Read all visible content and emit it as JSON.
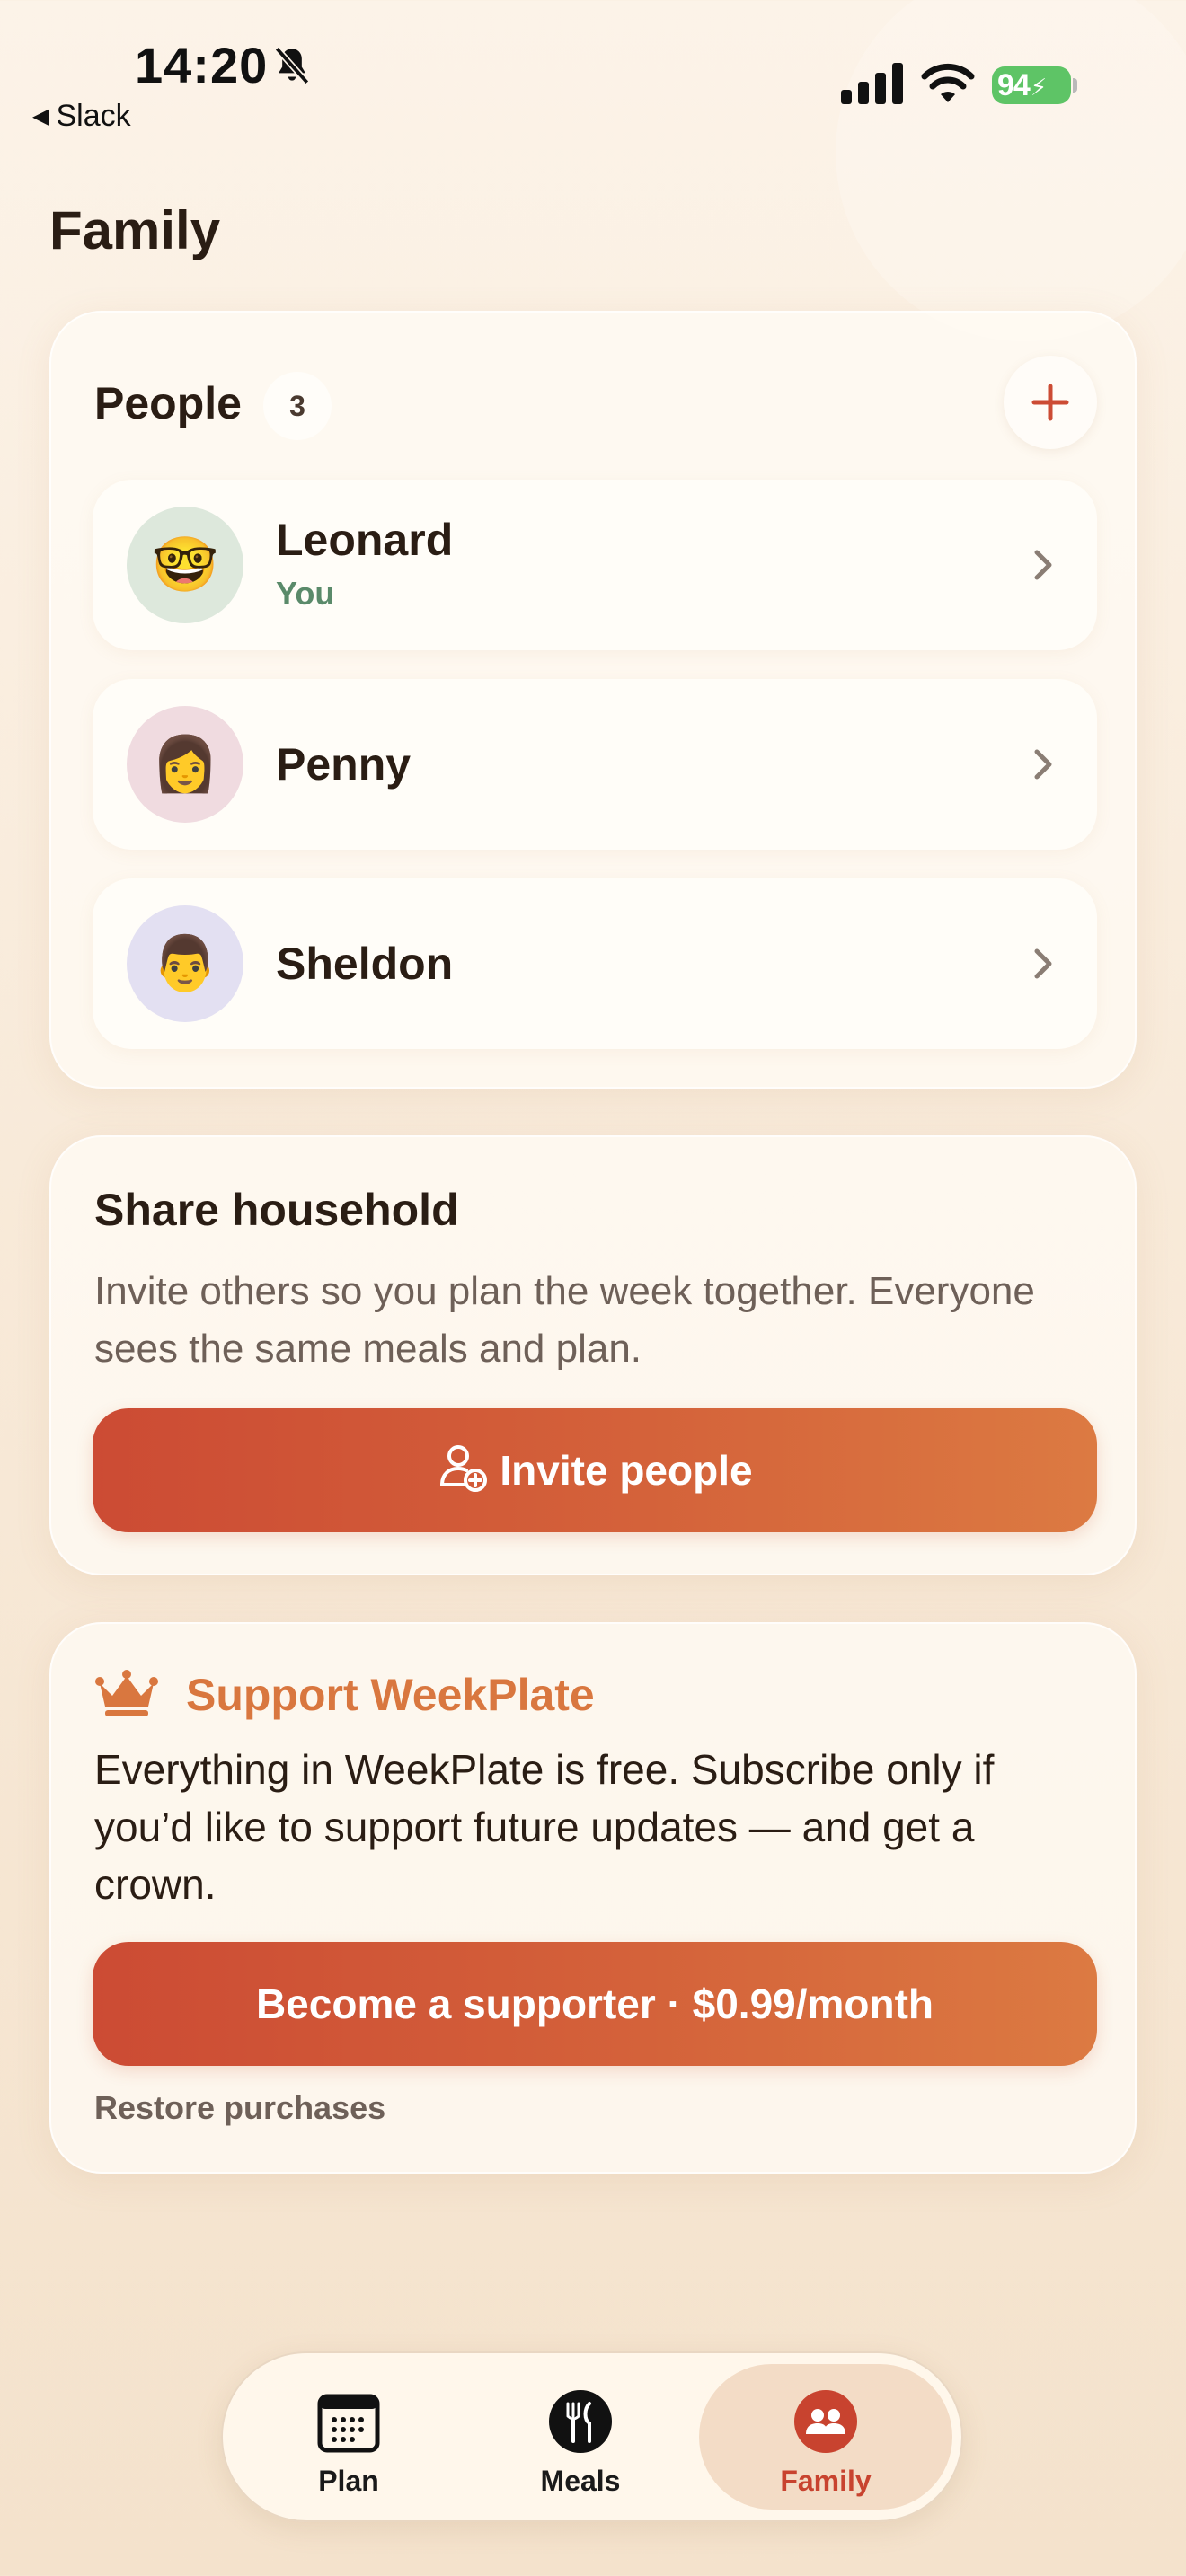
{
  "status_bar": {
    "time": "14:20",
    "back_app": "Slack",
    "battery": "94",
    "icons": [
      "bell-slash-icon",
      "cellular-signal-icon",
      "wifi-icon",
      "battery-charging-icon"
    ]
  },
  "page": {
    "title": "Family"
  },
  "people": {
    "title": "People",
    "count": "3",
    "add_icon": "plus-icon",
    "members": [
      {
        "name": "Leonard",
        "subtitle": "You",
        "avatar": "🤓",
        "avatar_bg": "#dde8dc"
      },
      {
        "name": "Penny",
        "subtitle": "",
        "avatar": "👩",
        "avatar_bg": "#f0dbe0"
      },
      {
        "name": "Sheldon",
        "subtitle": "",
        "avatar": "👨",
        "avatar_bg": "#e3e0f2"
      }
    ]
  },
  "share": {
    "title": "Share household",
    "body": "Invite others so you plan the week together. Everyone sees the same meals and plan.",
    "button_label": "Invite people",
    "button_icon": "person-add-icon"
  },
  "support": {
    "icon": "crown-icon",
    "title": "Support WeekPlate",
    "body": "Everything in WeekPlate is free. Subscribe only if you’d like to support future updates — and get a crown.",
    "button_label": "Become a supporter · $0.99/month",
    "restore_label": "Restore purchases"
  },
  "tab_bar": {
    "tabs": [
      {
        "label": "Plan",
        "icon": "calendar-icon",
        "selected": false
      },
      {
        "label": "Meals",
        "icon": "fork-knife-icon",
        "selected": false
      },
      {
        "label": "Family",
        "icon": "people-icon",
        "selected": true
      }
    ]
  },
  "colors": {
    "accent": "#cc4b34",
    "accent_end": "#dc7a42",
    "support_title": "#d9773f",
    "you_label": "#5a8a6a",
    "background": "#f8ead9"
  }
}
